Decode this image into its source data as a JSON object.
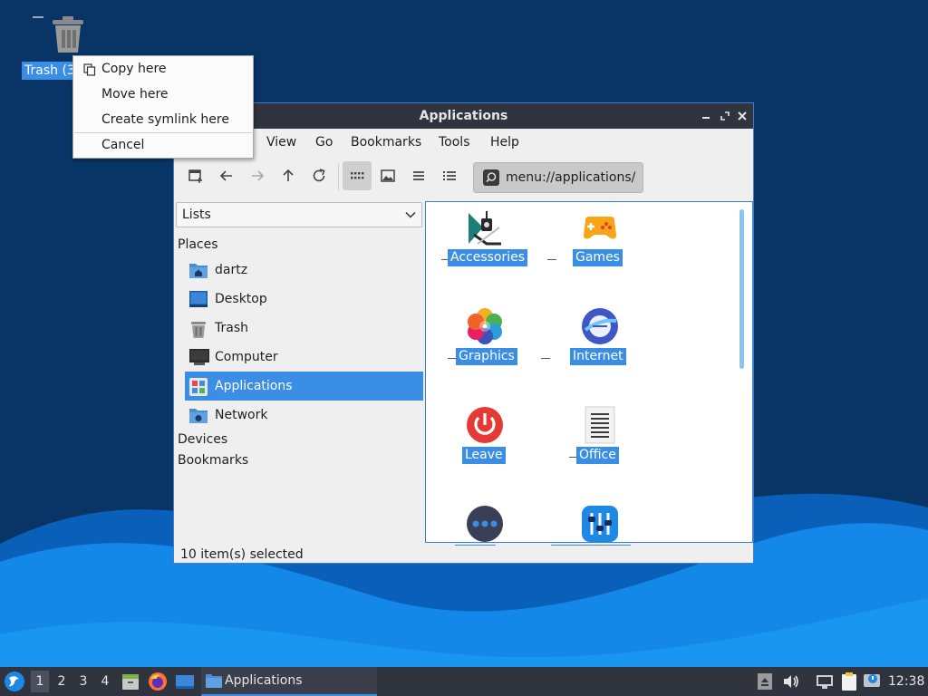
{
  "desktop": {
    "trash_label": "Trash (3"
  },
  "context_menu": {
    "items": [
      {
        "label": "Copy here",
        "icon": "copy-icon"
      },
      {
        "label": "Move here"
      },
      {
        "label": "Create symlink here"
      },
      {
        "label": "Cancel"
      }
    ]
  },
  "window": {
    "title": "Applications",
    "menus": [
      "View",
      "Go",
      "Bookmarks",
      "Tools",
      "Help"
    ],
    "location": "menu://applications/",
    "side_pane": {
      "mode": "Lists",
      "places_heading": "Places",
      "places": [
        {
          "label": "dartz",
          "icon": "home-folder-icon"
        },
        {
          "label": "Desktop",
          "icon": "desktop-icon"
        },
        {
          "label": "Trash",
          "icon": "trash-icon"
        },
        {
          "label": "Computer",
          "icon": "computer-icon"
        },
        {
          "label": "Applications",
          "icon": "applications-icon",
          "selected": true
        },
        {
          "label": "Network",
          "icon": "network-folder-icon"
        }
      ],
      "devices_heading": "Devices",
      "bookmarks_heading": "Bookmarks"
    },
    "apps": [
      {
        "label": "Accessories",
        "icon": "accessories-icon"
      },
      {
        "label": "Games",
        "icon": "games-icon"
      },
      {
        "label": "Graphics",
        "icon": "graphics-icon"
      },
      {
        "label": "Internet",
        "icon": "internet-icon"
      },
      {
        "label": "Leave",
        "icon": "leave-icon"
      },
      {
        "label": "Office",
        "icon": "office-icon"
      },
      {
        "label": "",
        "icon": "more-icon"
      },
      {
        "label": "",
        "icon": "settings-icon"
      }
    ],
    "status": "10 item(s) selected"
  },
  "taskbar": {
    "workspaces": [
      "1",
      "2",
      "3",
      "4"
    ],
    "active_workspace": "1",
    "task_label": "Applications",
    "clock": "12:38"
  },
  "colors": {
    "selection": "#3a8ee6",
    "titlebar": "#2f343f",
    "desktop_dark": "#083565",
    "wave_light": "#1488e8"
  }
}
